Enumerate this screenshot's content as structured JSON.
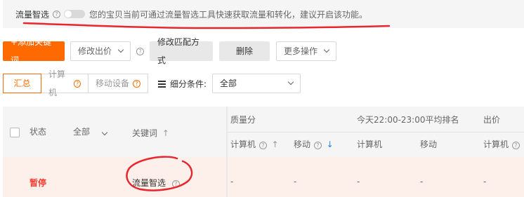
{
  "notice": {
    "title": "流量智选",
    "help_icon": "?",
    "description": "您的宝贝当前可通过流量智选工具快速获取流量和转化，建议开启该功能。"
  },
  "toolbar": {
    "add_keyword": "+添加关键词",
    "modify_bid": "修改出价",
    "modify_match": "修改匹配方式",
    "delete": "删除",
    "more_actions": "更多操作"
  },
  "tabs": {
    "summary": "汇总",
    "computer": "计算机",
    "mobile": "移动设备"
  },
  "filter": {
    "label": "细分条件:",
    "value": "全部"
  },
  "table": {
    "headers": {
      "status": "状态",
      "status_filter": "全部",
      "keyword": "关键词",
      "keyword_sort": "↑",
      "quality": "质量分",
      "quality_computer": "计算机",
      "quality_mobile": "移动",
      "avg_rank": "今天22:00-23:00平均排名",
      "rank_computer": "计算机",
      "rank_mobile": "移动",
      "bid": "出价",
      "bid_computer": "计算机"
    },
    "sort_up": "↑",
    "sort_down": "↓",
    "rows": [
      {
        "status": "暂停",
        "keyword": "流量智选",
        "quality_computer": "-",
        "quality_mobile": "-",
        "rank_computer": "-",
        "rank_mobile": "-",
        "bid_computer": "-"
      }
    ]
  },
  "colors": {
    "accent": "#ff6a00",
    "pause_status": "#ff3b30",
    "annotation": "#e8262e"
  }
}
